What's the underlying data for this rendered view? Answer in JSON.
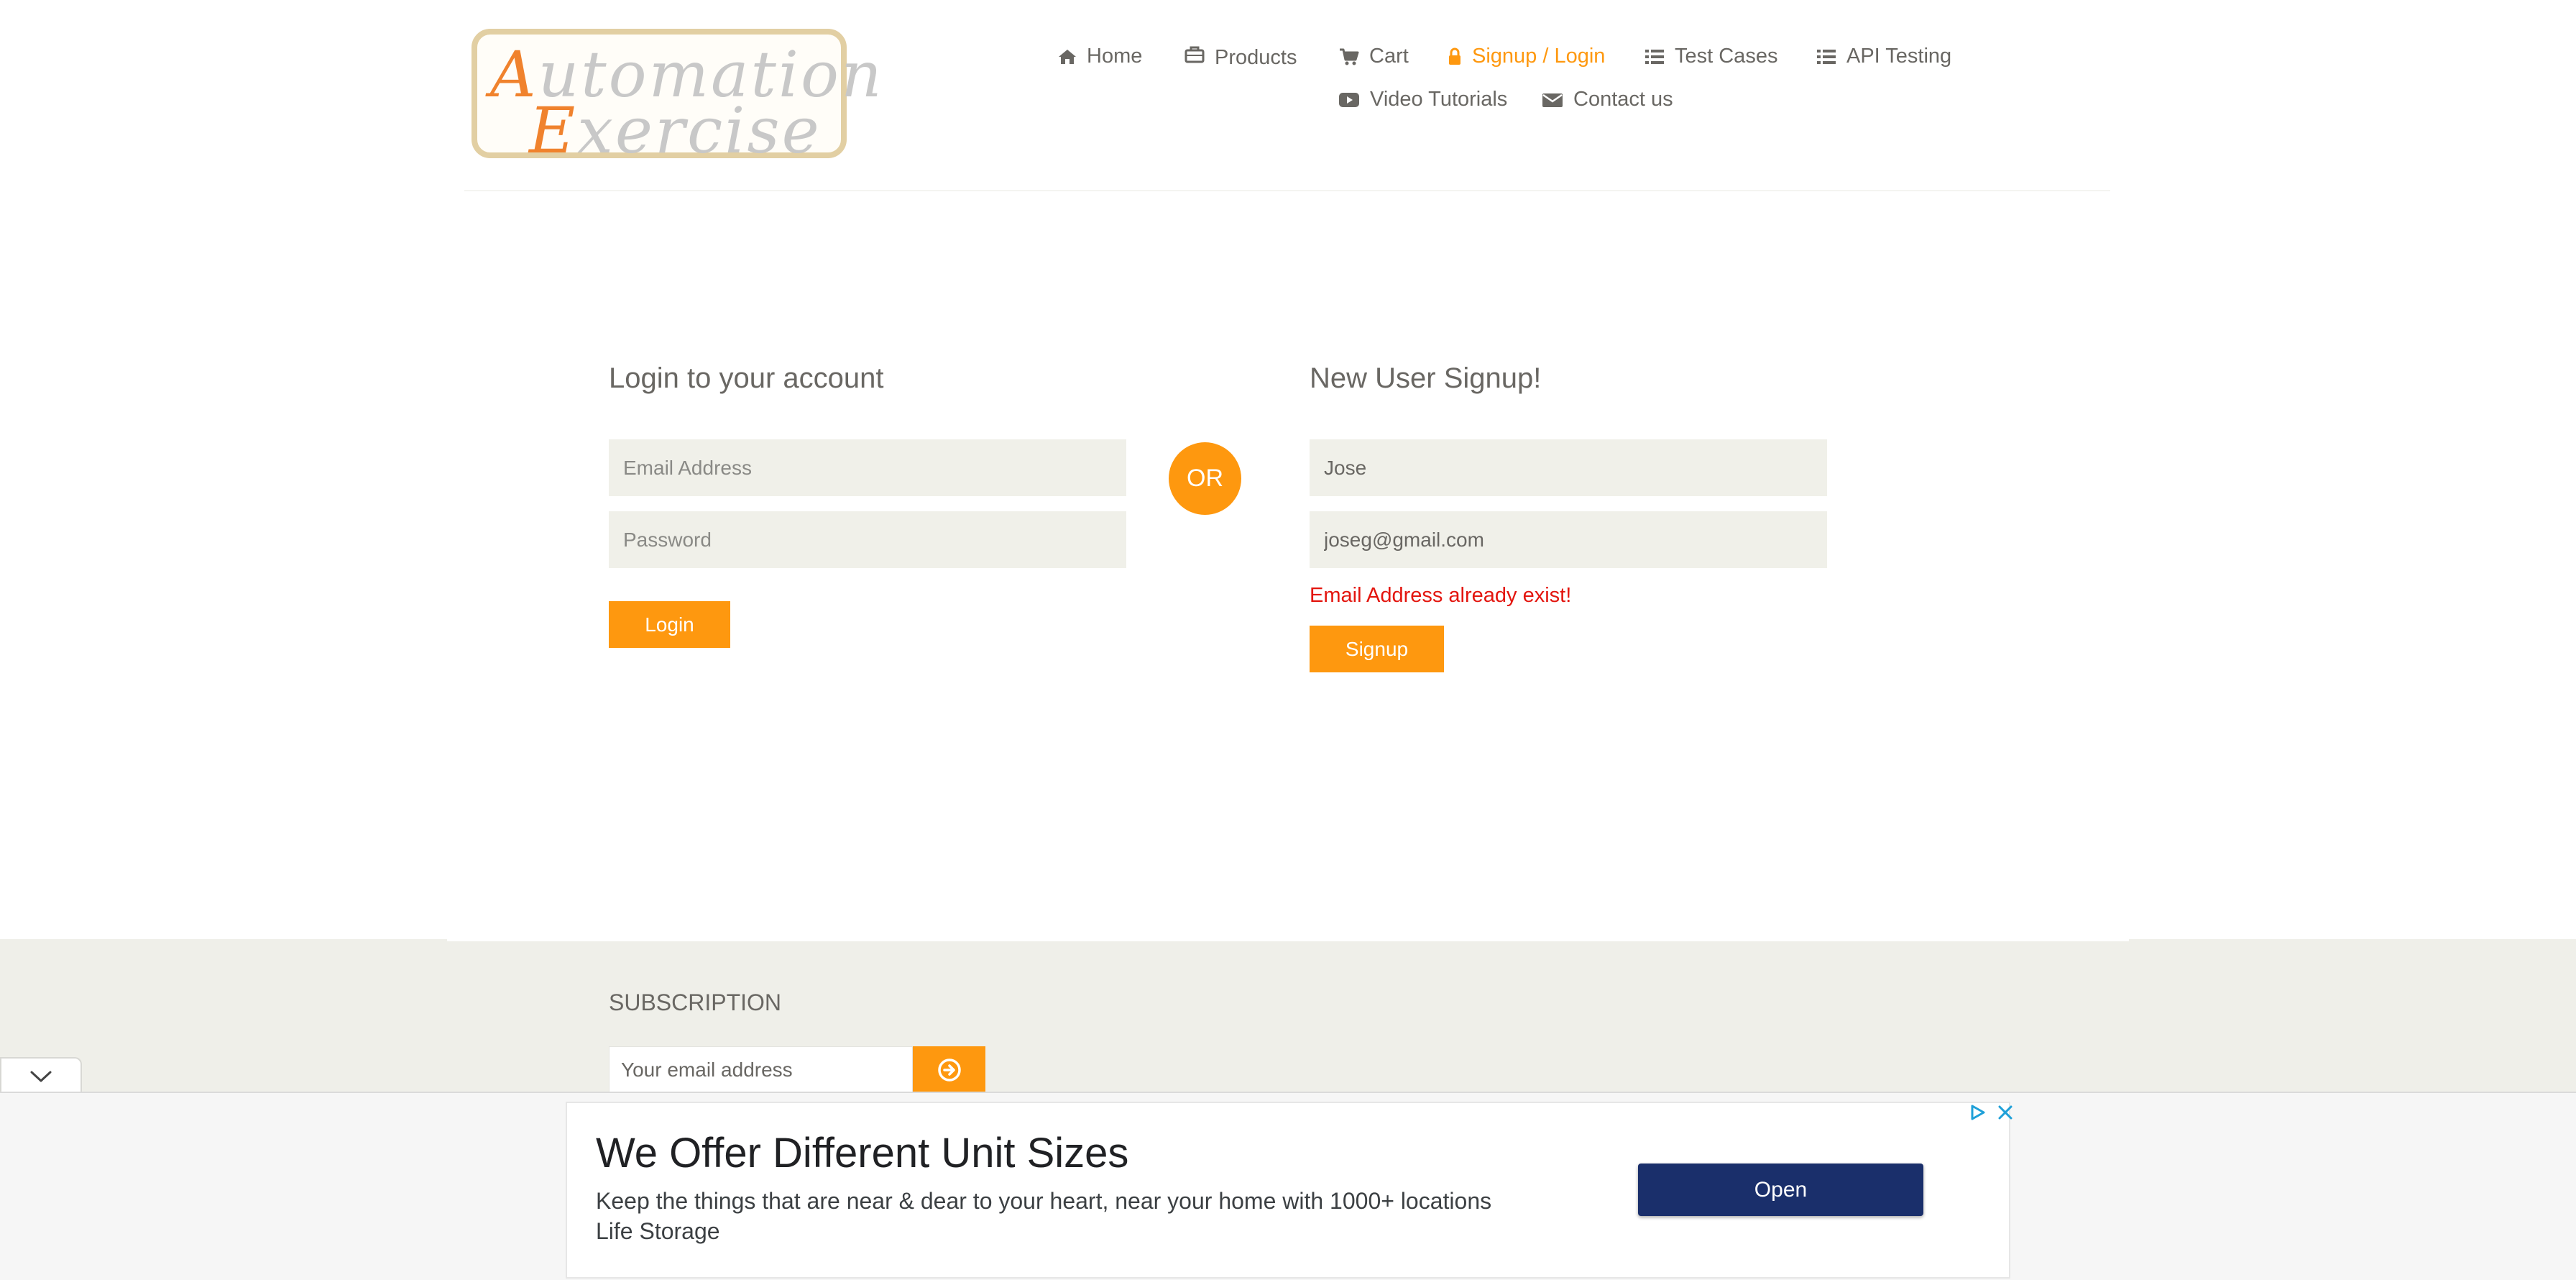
{
  "header": {
    "logo_text_line1": "Automation",
    "logo_text_line2": "Exercise",
    "nav": [
      {
        "label": "Home",
        "icon": "home-icon"
      },
      {
        "label": "Products",
        "icon": "briefcase-icon"
      },
      {
        "label": "Cart",
        "icon": "cart-icon"
      },
      {
        "label": "Signup / Login",
        "icon": "lock-icon",
        "active": true
      },
      {
        "label": "Test Cases",
        "icon": "list-icon"
      },
      {
        "label": "API Testing",
        "icon": "list-icon"
      },
      {
        "label": "Video Tutorials",
        "icon": "youtube-play-icon"
      },
      {
        "label": "Contact us",
        "icon": "envelope-icon"
      }
    ]
  },
  "login": {
    "title": "Login to your account",
    "email_placeholder": "Email Address",
    "password_placeholder": "Password",
    "button": "Login"
  },
  "separator": "OR",
  "signup": {
    "title": "New User Signup!",
    "name_value": "Jose",
    "email_value": "joseg@gmail.com",
    "error": "Email Address already exist!",
    "button": "Signup"
  },
  "footer": {
    "subscription_title": "SUBSCRIPTION",
    "email_placeholder": "Your email address"
  },
  "ad": {
    "title": "We Offer Different Unit Sizes",
    "description": "Keep the things that are near & dear to your heart, near your home with 1000+ locations",
    "source": "Life Storage",
    "button": "Open"
  },
  "colors": {
    "accent": "#fe980f",
    "text": "#696763",
    "field_bg": "#f0f0e9",
    "error": "#e3150e",
    "ad_button": "#1a2f6b"
  }
}
